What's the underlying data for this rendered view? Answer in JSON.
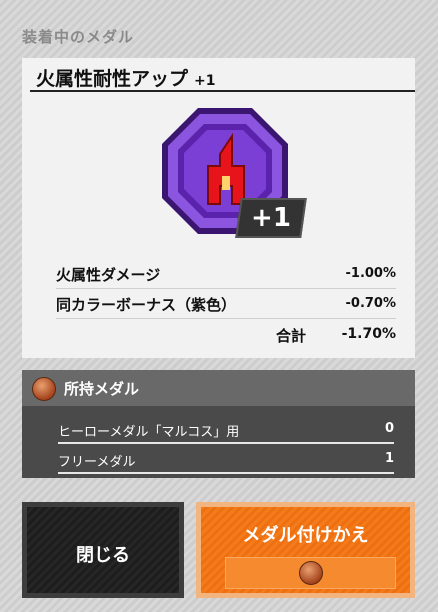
{
  "header": {
    "title": "装着中のメダル"
  },
  "medal": {
    "name": "火属性耐性アップ",
    "level_label": "+1",
    "badge": "+1",
    "icon": "fire-resist-medal-icon",
    "colors": {
      "rim": "#4b1f8c",
      "face": "#7a3ed1",
      "emblem": "#e21b1b"
    }
  },
  "stats": [
    {
      "label": "火属性ダメージ",
      "value": "-1.00%"
    },
    {
      "label": "同カラーボーナス（紫色）",
      "value": "-0.70%"
    }
  ],
  "total": {
    "label": "合計",
    "value": "-1.70%"
  },
  "owned": {
    "title": "所持メダル",
    "icon": "medal-coin-icon",
    "rows": [
      {
        "label": "ヒーローメダル「マルコス」用",
        "value": "0"
      },
      {
        "label": "フリーメダル",
        "value": "1"
      }
    ]
  },
  "buttons": {
    "close_label": "閉じる",
    "swap_label": "メダル付けかえ",
    "swap_icon": "medal-coin-icon"
  }
}
